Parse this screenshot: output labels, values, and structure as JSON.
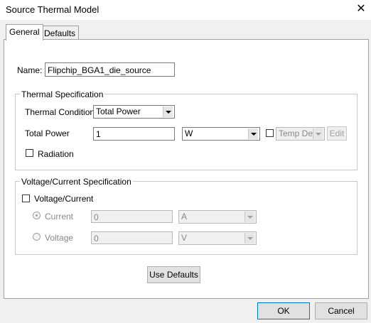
{
  "window": {
    "title": "Source Thermal Model",
    "close_glyph": "✕"
  },
  "tabs": [
    {
      "label": "General",
      "active": true
    },
    {
      "label": "Defaults",
      "active": false
    }
  ],
  "name_field": {
    "label": "Name:",
    "value": "Flipchip_BGA1_die_source"
  },
  "thermal": {
    "group_title": "Thermal Specification",
    "condition_label": "Thermal Condition",
    "condition_value": "Total Power",
    "power_label": "Total Power",
    "power_value": "1",
    "unit_value": "W",
    "temp_dep_label": "Temp Dep",
    "edit_label": "Edit",
    "radiation_label": "Radiation"
  },
  "voltage": {
    "group_title": "Voltage/Current Specification",
    "checkbox_label": "Voltage/Current",
    "current_label": "Current",
    "current_value": "0",
    "current_unit": "A",
    "voltage_label": "Voltage",
    "voltage_value": "0",
    "voltage_unit": "V"
  },
  "buttons": {
    "use_defaults": "Use Defaults",
    "ok": "OK",
    "cancel": "Cancel"
  }
}
